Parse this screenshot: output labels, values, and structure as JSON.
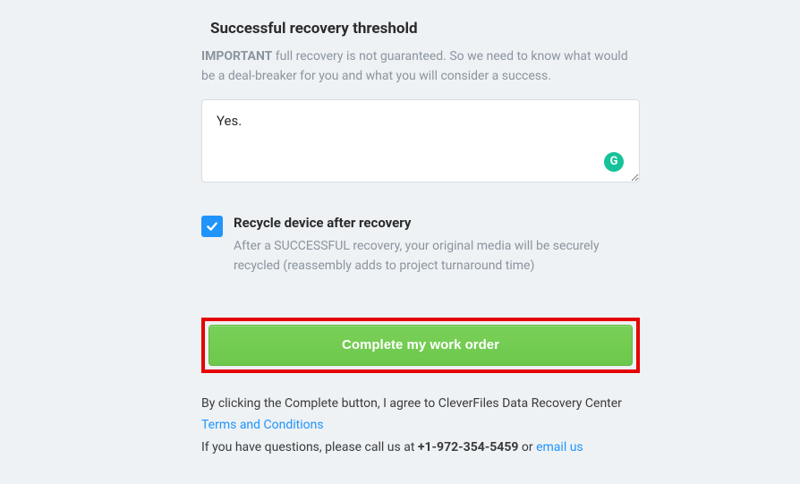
{
  "threshold": {
    "heading": "Successful recovery threshold",
    "important_label": "IMPORTANT",
    "description_rest": " full recovery is not guaranteed. So we need to know what would be a deal-breaker for you and what you will consider a success.",
    "textarea_value": "Yes."
  },
  "recycle": {
    "checked": true,
    "label": "Recycle device after recovery",
    "description": "After a SUCCESSFUL recovery, your original media will be securely recycled (reassembly adds to project turnaround time)"
  },
  "submit": {
    "label": "Complete my work order"
  },
  "footer": {
    "agree_prefix": "By clicking the Complete button, I agree to CleverFiles Data Recovery Center ",
    "terms_link": "Terms and Conditions",
    "questions_prefix": "If you have questions, please call us at ",
    "phone": "+1-972-354-5459",
    "or": " or ",
    "email_link": "email us"
  }
}
